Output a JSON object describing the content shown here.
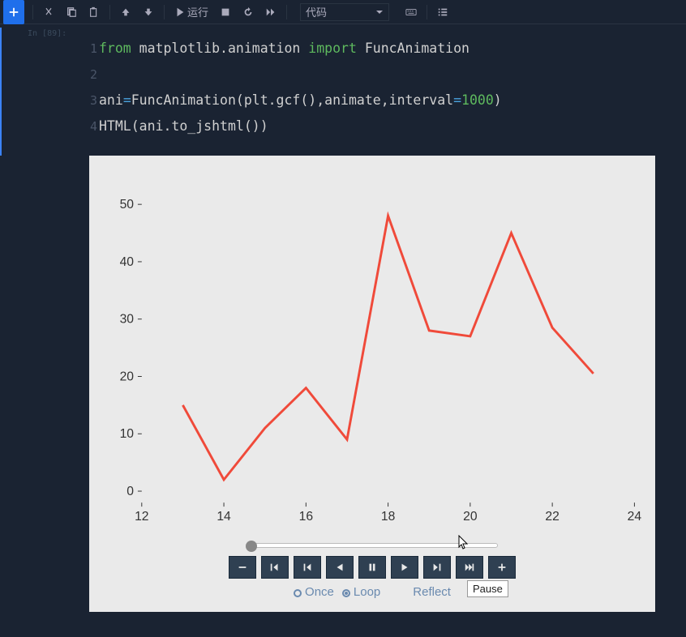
{
  "toolbar": {
    "run_label": "运行",
    "celltype": "代码"
  },
  "prompt": "In [89]:",
  "code": {
    "l1": {
      "kw1": "from",
      "mod": " matplotlib.animation ",
      "kw2": "import",
      "fn": " FuncAnimation"
    },
    "l3_a": "ani",
    "l3_b": "=",
    "l3_c": "FuncAnimation",
    "l3_d": "(plt.gcf(),animate,interval",
    "l3_e": "=",
    "l3_num": "1000",
    "l3_f": ")",
    "l4_a": "HTML",
    "l4_b": "(ani.to_jshtml())"
  },
  "chart_data": {
    "type": "line",
    "x": [
      13,
      14,
      15,
      16,
      17,
      18,
      19,
      20,
      21,
      22,
      23
    ],
    "y": [
      15,
      2,
      11,
      18,
      9,
      48,
      28,
      27,
      45,
      28.5,
      20.5
    ],
    "xticks": [
      12,
      14,
      16,
      18,
      20,
      22,
      24
    ],
    "yticks": [
      0,
      10,
      20,
      30,
      40,
      50
    ],
    "xlim": [
      12,
      24
    ],
    "ylim": [
      -2,
      52
    ],
    "line_color": "#f04a3a"
  },
  "animation": {
    "tooltip": "Pause",
    "modes": [
      "Once",
      "Loop",
      "Reflect"
    ],
    "selected_mode": "Loop"
  }
}
